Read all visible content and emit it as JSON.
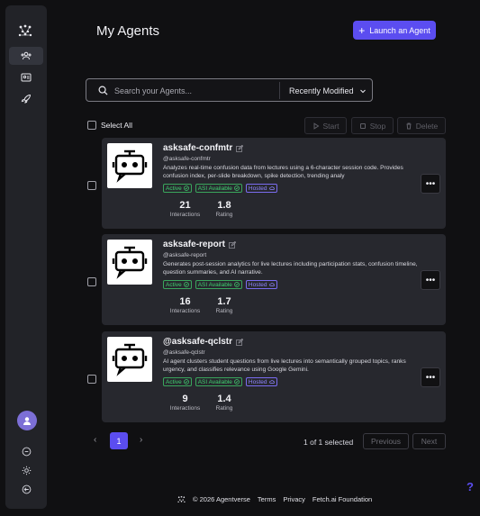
{
  "page": {
    "title": "My Agents"
  },
  "header": {
    "launch_label": "Launch an Agent"
  },
  "search": {
    "placeholder": "Search your Agents...",
    "sort_value": "Recently Modified"
  },
  "toolbar": {
    "select_all": "Select All",
    "start": "Start",
    "stop": "Stop",
    "delete": "Delete"
  },
  "agents": [
    {
      "name": "asksafe-confmtr",
      "handle": "@asksafe-confmtr",
      "description": "Analyzes real-time confusion data from lectures using a 6-character session code. Provides confusion index, per-slide breakdown, spike detection, trending analy",
      "badges": [
        "Active",
        "ASI Available",
        "Hosted"
      ],
      "interactions": "21",
      "interactions_label": "Interactions",
      "rating": "1.8",
      "rating_label": "Rating"
    },
    {
      "name": "asksafe-report",
      "handle": "@asksafe-report",
      "description": "Generates post-session analytics for live lectures including participation stats, confusion timeline, question summaries, and AI narrative.",
      "badges": [
        "Active",
        "ASI Available",
        "Hosted"
      ],
      "interactions": "16",
      "interactions_label": "Interactions",
      "rating": "1.7",
      "rating_label": "Rating"
    },
    {
      "name": "@asksafe-qclstr",
      "handle": "@asksafe-qclstr",
      "description": "AI agent clusters student questions from live lectures into semantically grouped topics, ranks urgency, and classifies relevance using Google Gemini.",
      "badges": [
        "Active",
        "ASI Available",
        "Hosted"
      ],
      "interactions": "9",
      "interactions_label": "Interactions",
      "rating": "1.4",
      "rating_label": "Rating"
    }
  ],
  "pagination": {
    "prev_arrow": "‹",
    "next_arrow": "›",
    "current_page": "1",
    "selected": "1 of 1 selected",
    "previous": "Previous",
    "next": "Next"
  },
  "footer": {
    "copyright": "© 2026 Agentverse",
    "links": [
      "Terms",
      "Privacy",
      "Fetch.ai Foundation"
    ]
  },
  "help": {
    "label": "?"
  },
  "colors": {
    "accent": "#5b4df0",
    "active_green": "#3fd06f",
    "hosted_purple": "#8f84ff",
    "card_bg": "#27282e"
  },
  "icons": {
    "sidebar": [
      "logo-icon",
      "agents-icon",
      "contacts-card-icon",
      "rocket-icon",
      "help-circle-icon",
      "sun-icon",
      "logout-icon"
    ]
  }
}
